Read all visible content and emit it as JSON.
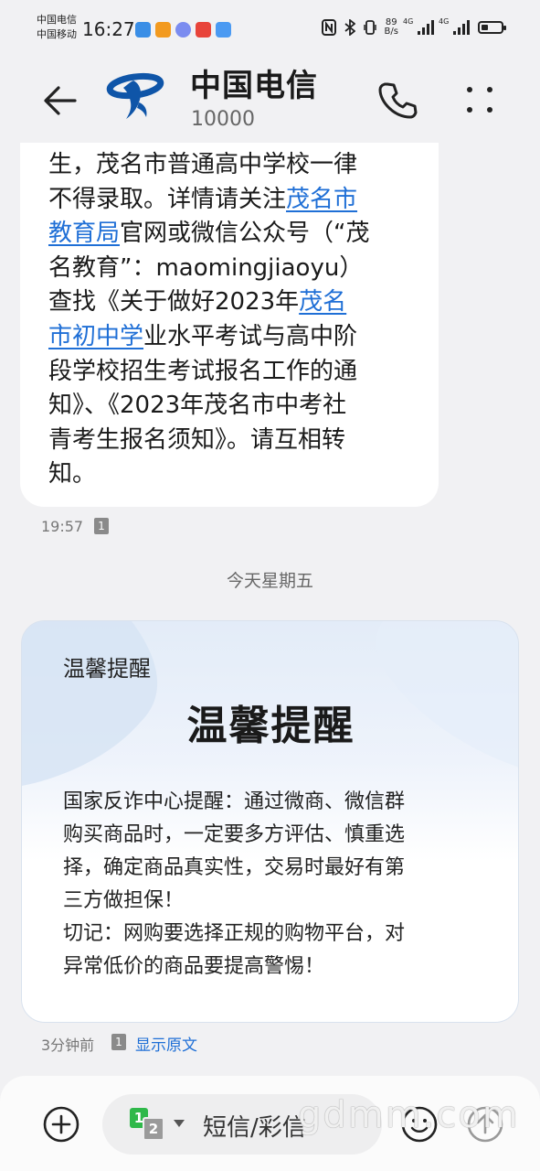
{
  "status_bar": {
    "carrier_1": "中国电信",
    "carrier_2": "中国移动",
    "time": "16:27",
    "net_speed_value": "89",
    "net_speed_unit": "B/s",
    "signal_1_label": "4G",
    "signal_2_label": "4G",
    "battery_level": 0.35
  },
  "header": {
    "contact_name": "中国电信",
    "contact_number": "10000",
    "brand_color": "#0f55a8"
  },
  "message_1": {
    "lines": [
      [
        {
          "t": "生，茂名市普通高中学校一律"
        }
      ],
      [
        {
          "t": "不得录取。详情请关注"
        },
        {
          "t": "茂名市",
          "link": true
        }
      ],
      [
        {
          "t": "教育局",
          "link": true
        },
        {
          "t": "官网或微信公众号（“茂"
        }
      ],
      [
        {
          "t": "名教育”：maomingjiaoyu）"
        }
      ],
      [
        {
          "t": "查找《关于做好2023年"
        },
        {
          "t": "茂名",
          "link": true
        }
      ],
      [
        {
          "t": "市初中学",
          "link": true
        },
        {
          "t": "业水平考试与高中阶"
        }
      ],
      [
        {
          "t": "段学校招生考试报名工作的通"
        }
      ],
      [
        {
          "t": "知》、《2023年茂名市中考社"
        }
      ],
      [
        {
          "t": "青考生报名须知》。请互相转"
        }
      ],
      [
        {
          "t": "知。"
        }
      ]
    ],
    "time": "19:57",
    "sim": "1"
  },
  "day_divider": "今天星期五",
  "card": {
    "label": "温馨提醒",
    "title": "温馨提醒",
    "body_lines": [
      "国家反诈中心提醒：通过微商、微信群",
      "购买商品时，一定要多方评估、慎重选",
      "择，确定商品真实性，交易时最好有第",
      "三方做担保！",
      "切记：网购要选择正规的购物平台，对",
      "异常低价的商品要提高警惕！"
    ],
    "time": "3分钟前",
    "sim": "1",
    "show_original": "显示原文"
  },
  "compose": {
    "sim_primary": "1",
    "sim_secondary": "2",
    "placeholder": "短信/彩信"
  },
  "watermark": "gdmm.com",
  "colors": {
    "link": "#1f6fd6",
    "sim_green": "#2fb84a"
  }
}
